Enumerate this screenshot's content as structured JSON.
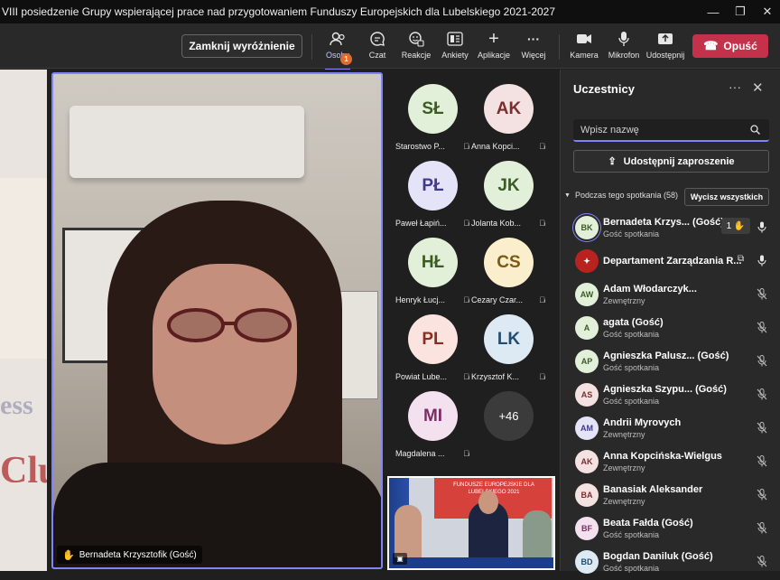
{
  "window": {
    "title": "VIII posiedzenie Grupy wspierającej prace nad przygotowaniem Funduszy Europejskich dla Lubelskiego 2021-2027"
  },
  "toolbar": {
    "stop_spotlight": "Zamknij wyróżnienie",
    "people": {
      "label": "Osoby",
      "badge": "1"
    },
    "chat": "Czat",
    "reactions": "Reakcje",
    "polls": "Ankiety",
    "apps": "Aplikacje",
    "more": "Więcej",
    "camera": "Kamera",
    "mic": "Mikrofon",
    "share": "Udostępnij",
    "leave": "Opuść",
    "accent": "#7f85f5",
    "leave_color": "#c4314b"
  },
  "stage": {
    "speaker_name": "Bernadeta Krzysztofik (Gość)",
    "tiles": [
      {
        "initials": "SŁ",
        "name": "Starostwo P...",
        "bg": "#e2f0d9",
        "fg": "#3b5a24"
      },
      {
        "initials": "AK",
        "name": "Anna Kopci...",
        "bg": "#f4e1e1",
        "fg": "#7a2e2e"
      },
      {
        "initials": "PŁ",
        "name": "Paweł Łapiń...",
        "bg": "#e4e3f7",
        "fg": "#3f3a8a"
      },
      {
        "initials": "JK",
        "name": "Jolanta Kob...",
        "bg": "#e2f0d9",
        "fg": "#3b5a24"
      },
      {
        "initials": "HŁ",
        "name": "Henryk Łucj...",
        "bg": "#e2f0d9",
        "fg": "#3b5a24"
      },
      {
        "initials": "CS",
        "name": "Cezary Czar...",
        "bg": "#fbeecd",
        "fg": "#7a5a14"
      },
      {
        "initials": "PL",
        "name": "Powiat Lube...",
        "bg": "#fbe3df",
        "fg": "#8a2e22"
      },
      {
        "initials": "LK",
        "name": "Krzysztof K...",
        "bg": "#dde9f3",
        "fg": "#214d72"
      },
      {
        "initials": "MI",
        "name": "Magdalena ...",
        "bg": "#f4e1ef",
        "fg": "#7a2e64"
      }
    ],
    "more_count": "+46",
    "conf_banner": "FUNDUSZE EUROPEJSKIE DLA LUBELSKIEGO 2021"
  },
  "panel": {
    "title": "Uczestnicy",
    "search_placeholder": "Wpisz nazwę",
    "share_invite": "Udostępnij zaproszenie",
    "section_label": "Podczas tego spotkania (58)",
    "mute_all": "Wycisz wszystkich",
    "participants": [
      {
        "initials": "BK",
        "name": "Bernadeta Krzys... (Gość)",
        "role": "Gość spotkania",
        "bg": "#e2f0d9",
        "fg": "#3b5a24",
        "hand": "1 ✋",
        "mic": "on",
        "selected": true
      },
      {
        "initials": "",
        "name": "Departament Zarządzania R...",
        "role": "",
        "bg": "#b8231f",
        "fg": "#fff",
        "mic": "on",
        "share": true
      },
      {
        "initials": "AW",
        "name": "Adam Włodarczyk...",
        "role": "Zewnętrzny",
        "bg": "#e2f0d9",
        "fg": "#3b5a24",
        "mic": "off"
      },
      {
        "initials": "A",
        "name": "agata (Gość)",
        "role": "Gość spotkania",
        "bg": "#e2f0d9",
        "fg": "#3b5a24",
        "mic": "off"
      },
      {
        "initials": "AP",
        "name": "Agnieszka Palusz... (Gość)",
        "role": "Gość spotkania",
        "bg": "#e2f0d9",
        "fg": "#3b5a24",
        "mic": "off"
      },
      {
        "initials": "AS",
        "name": "Agnieszka Szypu... (Gość)",
        "role": "Gość spotkania",
        "bg": "#f4e1e1",
        "fg": "#7a2e2e",
        "mic": "off"
      },
      {
        "initials": "AM",
        "name": "Andrii Myrovych",
        "role": "Zewnętrzny",
        "bg": "#e4e3f7",
        "fg": "#3f3a8a",
        "mic": "off"
      },
      {
        "initials": "AK",
        "name": "Anna Kopcińska-Wielgus",
        "role": "Zewnętrzny",
        "bg": "#f4e1e1",
        "fg": "#7a2e2e",
        "mic": "off"
      },
      {
        "initials": "BA",
        "name": "Banasiak Aleksander",
        "role": "Zewnętrzny",
        "bg": "#f4e1e1",
        "fg": "#7a2e2e",
        "mic": "off"
      },
      {
        "initials": "BF",
        "name": "Beata Fałda (Gość)",
        "role": "Gość spotkania",
        "bg": "#f4e1ef",
        "fg": "#7a2e64",
        "mic": "off"
      },
      {
        "initials": "BD",
        "name": "Bogdan Daniluk (Gość)",
        "role": "Gość spotkania",
        "bg": "#dde9f3",
        "fg": "#214d72",
        "mic": "off"
      }
    ]
  }
}
